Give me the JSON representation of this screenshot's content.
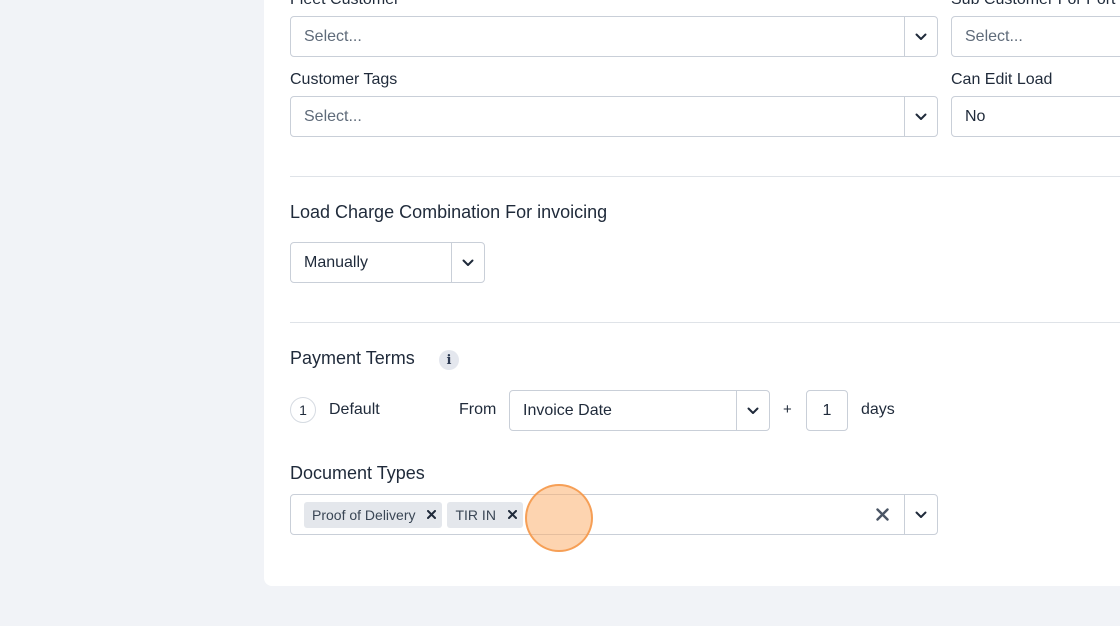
{
  "fields": {
    "fleet_customer": {
      "label": "Fleet Customer",
      "placeholder": "Select..."
    },
    "sub_customer_for_port": {
      "label": "Sub Customer For Port",
      "placeholder": "Select..."
    },
    "customer_tags": {
      "label": "Customer Tags",
      "placeholder": "Select..."
    },
    "can_edit_load": {
      "label": "Can Edit Load",
      "value": "No"
    }
  },
  "load_charge": {
    "title": "Load Charge Combination For invoicing",
    "value": "Manually"
  },
  "payment_terms": {
    "title": "Payment Terms",
    "info_icon": "i",
    "row": {
      "index": "1",
      "name": "Default",
      "from_label": "From",
      "from_value": "Invoice Date",
      "plus": "+",
      "days_value": "1",
      "days_label": "days"
    }
  },
  "document_types": {
    "title": "Document Types",
    "chips": [
      {
        "label": "Proof of Delivery"
      },
      {
        "label": "TIR IN"
      }
    ]
  },
  "icons": {
    "dropdown": "chevron-down-icon",
    "clear": "close-icon",
    "remove": "close-icon"
  },
  "colors": {
    "background": "#f1f3f7",
    "card": "#ffffff",
    "border": "#c9cfd8",
    "chip": "#e4e7ec",
    "click_marker": "#fbb070"
  }
}
